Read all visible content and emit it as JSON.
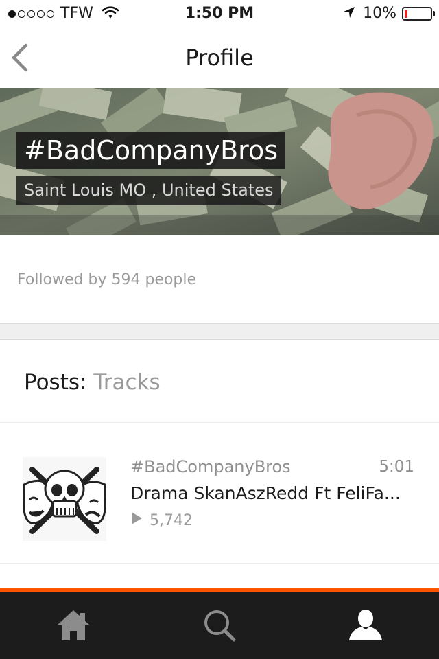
{
  "status_bar": {
    "carrier": "TFW",
    "time": "1:50 PM",
    "battery": "10%",
    "battery_level": 0.1,
    "signal_bars_filled": 1,
    "signal_bars_total": 5
  },
  "nav": {
    "title": "Profile",
    "back_icon": "chevron-left-icon"
  },
  "profile": {
    "name": "#BadCompanyBros",
    "location": "Saint Louis MO , United States",
    "followers_text": "Followed by 594 people"
  },
  "posts": {
    "label": "Posts:",
    "filter": "Tracks"
  },
  "tracks": [
    {
      "user": "#BadCompanyBros",
      "duration": "5:01",
      "title": "Drama SkanAszRedd Ft FeliFa...",
      "plays": "5,742",
      "artwork_icon": "skull-masks-artwork"
    }
  ],
  "tab_bar": {
    "items": [
      {
        "name": "home",
        "icon": "home-icon",
        "active": false
      },
      {
        "name": "search",
        "icon": "search-icon",
        "active": false
      },
      {
        "name": "profile",
        "icon": "user-icon",
        "active": true
      }
    ],
    "accent": "#ff5500",
    "background": "#1c1c1c"
  },
  "colors": {
    "text_primary": "#1b1b1b",
    "text_secondary": "#9a9a9a",
    "battery_low": "#e02a20"
  }
}
